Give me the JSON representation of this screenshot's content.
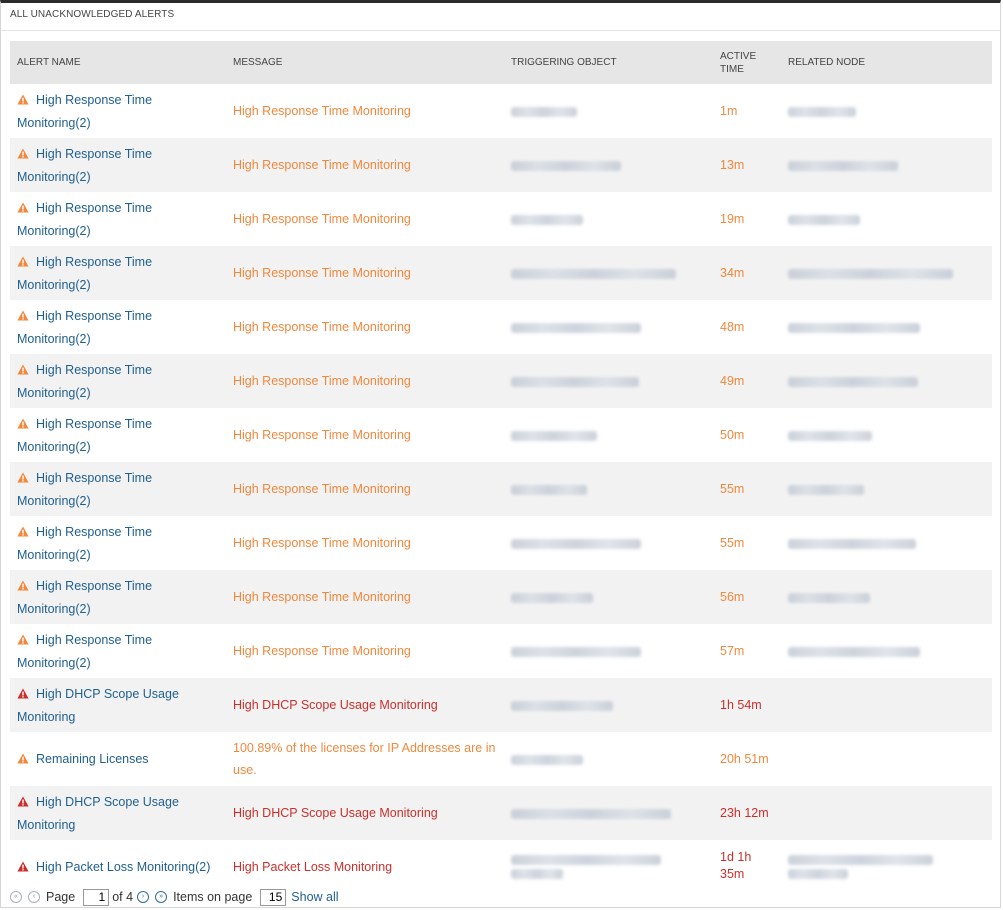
{
  "panel": {
    "title": "ALL UNACKNOWLEDGED ALERTS"
  },
  "columns": {
    "alert_name": "ALERT NAME",
    "message": "MESSAGE",
    "triggering_object": "TRIGGERING OBJECT",
    "active_time_1": "ACTIVE",
    "active_time_2": "TIME",
    "related_node": "RELATED NODE"
  },
  "colors": {
    "warning": "#f0883e",
    "critical": "#c9302c",
    "link": "#1f5f8f"
  },
  "alerts": [
    {
      "severity": "warning",
      "icon": "warning-icon",
      "name": "High Response Time Monitoring(2)",
      "message": "High Response Time Monitoring",
      "active_time": "1m"
    },
    {
      "severity": "warning",
      "icon": "warning-icon",
      "name": "High Response Time Monitoring(2)",
      "message": "High Response Time Monitoring",
      "active_time": "13m"
    },
    {
      "severity": "warning",
      "icon": "warning-icon",
      "name": "High Response Time Monitoring(2)",
      "message": "High Response Time Monitoring",
      "active_time": "19m"
    },
    {
      "severity": "warning",
      "icon": "warning-icon",
      "name": "High Response Time Monitoring(2)",
      "message": "High Response Time Monitoring",
      "active_time": "34m"
    },
    {
      "severity": "warning",
      "icon": "warning-icon",
      "name": "High Response Time Monitoring(2)",
      "message": "High Response Time Monitoring",
      "active_time": "48m"
    },
    {
      "severity": "warning",
      "icon": "warning-icon",
      "name": "High Response Time Monitoring(2)",
      "message": "High Response Time Monitoring",
      "active_time": "49m"
    },
    {
      "severity": "warning",
      "icon": "warning-icon",
      "name": "High Response Time Monitoring(2)",
      "message": "High Response Time Monitoring",
      "active_time": "50m"
    },
    {
      "severity": "warning",
      "icon": "warning-icon",
      "name": "High Response Time Monitoring(2)",
      "message": "High Response Time Monitoring",
      "active_time": "55m"
    },
    {
      "severity": "warning",
      "icon": "warning-icon",
      "name": "High Response Time Monitoring(2)",
      "message": "High Response Time Monitoring",
      "active_time": "55m"
    },
    {
      "severity": "warning",
      "icon": "warning-icon",
      "name": "High Response Time Monitoring(2)",
      "message": "High Response Time Monitoring",
      "active_time": "56m"
    },
    {
      "severity": "warning",
      "icon": "warning-icon",
      "name": "High Response Time Monitoring(2)",
      "message": "High Response Time Monitoring",
      "active_time": "57m"
    },
    {
      "severity": "critical",
      "icon": "critical-icon",
      "name": "High DHCP Scope Usage Monitoring",
      "message": "High DHCP Scope Usage Monitoring",
      "active_time": "1h 54m"
    },
    {
      "severity": "warning",
      "icon": "warning-icon",
      "name": "Remaining Licenses",
      "message": "100.89% of the licenses for IP Addresses are in use.",
      "active_time": "20h 51m"
    },
    {
      "severity": "critical",
      "icon": "critical-icon",
      "name": "High DHCP Scope Usage Monitoring",
      "message": "High DHCP Scope Usage Monitoring",
      "active_time": "23h 12m"
    },
    {
      "severity": "critical",
      "icon": "critical-icon",
      "name": "High Packet Loss Monitoring(2)",
      "message": "High Packet Loss Monitoring",
      "active_time": "1d 1h 35m"
    }
  ],
  "pager": {
    "page_label": "Page",
    "page_value": "1",
    "of_label": "of 4",
    "items_label": "Items on page",
    "items_value": "15",
    "show_all": "Show all"
  }
}
